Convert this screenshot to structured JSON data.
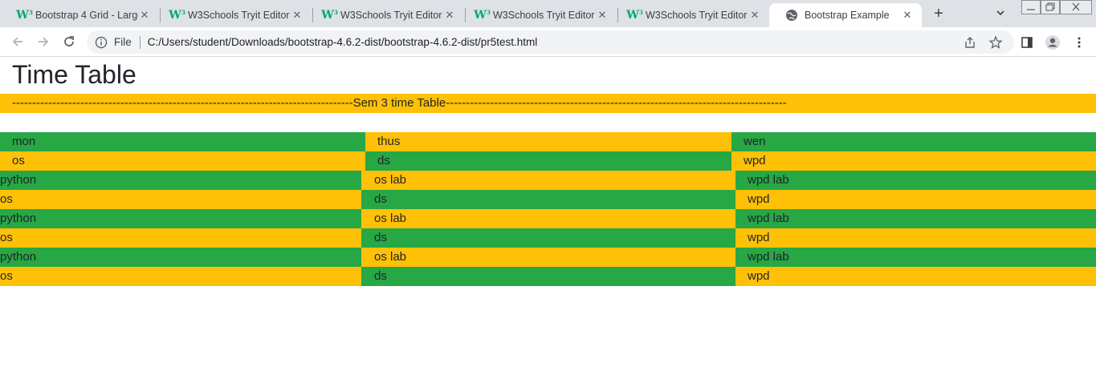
{
  "browser": {
    "tabs": [
      {
        "title": "Bootstrap 4 Grid - Large",
        "icon": "w3schools-icon",
        "active": false
      },
      {
        "title": "W3Schools Tryit Editor",
        "icon": "w3schools-icon",
        "active": false
      },
      {
        "title": "W3Schools Tryit Editor",
        "icon": "w3schools-icon",
        "active": false
      },
      {
        "title": "W3Schools Tryit Editor",
        "icon": "w3schools-icon",
        "active": false
      },
      {
        "title": "W3Schools Tryit Editor",
        "icon": "w3schools-icon",
        "active": false
      },
      {
        "title": "Bootstrap Example",
        "icon": "globe-icon",
        "active": true
      }
    ],
    "favicon_letter": "W",
    "favicon_sup": "3",
    "tab_close_glyph": "✕",
    "new_tab_glyph": "+",
    "address": {
      "scheme_label": "File",
      "url": "C:/Users/student/Downloads/bootstrap-4.6.2-dist/bootstrap-4.6.2-dist/pr5test.html"
    }
  },
  "page": {
    "heading": "Time Table",
    "banner": "-------------------------------------------------------------------------------------Sem 3 time Table-------------------------------------------------------------------------------------",
    "header_row": [
      "mon",
      "thus",
      "wen"
    ],
    "first_row": [
      "os",
      "ds",
      "wpd"
    ],
    "rows": [
      [
        "python",
        "os lab",
        "wpd lab"
      ],
      [
        "os",
        "ds",
        "wpd"
      ],
      [
        "python",
        "os lab",
        "wpd lab"
      ],
      [
        "os",
        "ds",
        "wpd"
      ],
      [
        "python",
        "os lab",
        "wpd lab"
      ],
      [
        "os",
        "ds",
        "wpd"
      ]
    ]
  },
  "colors": {
    "green": "#28a745",
    "yellow": "#ffc107",
    "tabstrip": "#dee1e6",
    "omnibox": "#f1f3f4"
  }
}
